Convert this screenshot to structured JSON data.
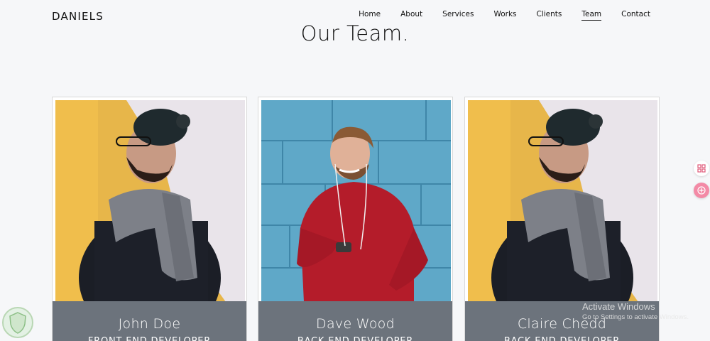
{
  "brand": "DANIELS",
  "nav": {
    "items": [
      {
        "label": "Home"
      },
      {
        "label": "About"
      },
      {
        "label": "Services"
      },
      {
        "label": "Works"
      },
      {
        "label": "Clients"
      },
      {
        "label": "Team",
        "active": true
      },
      {
        "label": "Contact"
      }
    ]
  },
  "section": {
    "title": "Our Team."
  },
  "team": [
    {
      "name": "John Doe",
      "role": "FRONT END DEVELOPER"
    },
    {
      "name": "Dave Wood",
      "role": "BACK END DEVELOPER"
    },
    {
      "name": "Claire Chedd",
      "role": "BACK END DEVELOPER"
    }
  ],
  "watermark": {
    "line1": "Activate Windows",
    "line2": "Go to Settings to activate Windows."
  },
  "icons": {
    "side1": "grid-icon",
    "side2": "translate-icon"
  },
  "colors": {
    "card_footer": "#6c737c",
    "accent": "#f38aa6"
  }
}
